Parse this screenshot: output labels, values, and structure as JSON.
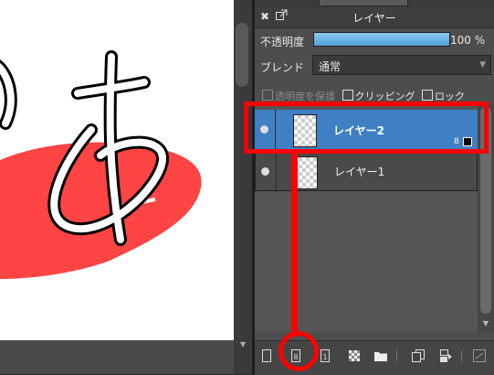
{
  "panel": {
    "title": "レイヤー",
    "opacity_label": "不透明度",
    "opacity_value": "100 %",
    "opacity_fraction": 1.0,
    "blend_label": "ブレンド",
    "blend_value": "通常",
    "checkboxes": [
      "透明度を保護",
      "クリッピング",
      "ロック"
    ],
    "layers": [
      {
        "name": "レイヤー2",
        "badge": "8",
        "selected": true
      },
      {
        "name": "レイヤー1",
        "selected": false
      }
    ]
  },
  "toolbar": {
    "buttons": [
      "new-layer-icon",
      "new-8bit-layer-icon",
      "new-1bit-layer-icon",
      "new-halftone-layer-icon",
      "new-folder-icon",
      "duplicate-layer-icon",
      "merge-down-icon",
      "mask-icon"
    ]
  },
  "canvas": {
    "character": "あ",
    "stroke_color": "#000000",
    "paint_color": "#ff4444"
  },
  "annotation": {
    "highlight_color": "#ff0000"
  },
  "colors": {
    "accent": "#3f7fc4",
    "opacity_bar": "#5aa8e0"
  }
}
